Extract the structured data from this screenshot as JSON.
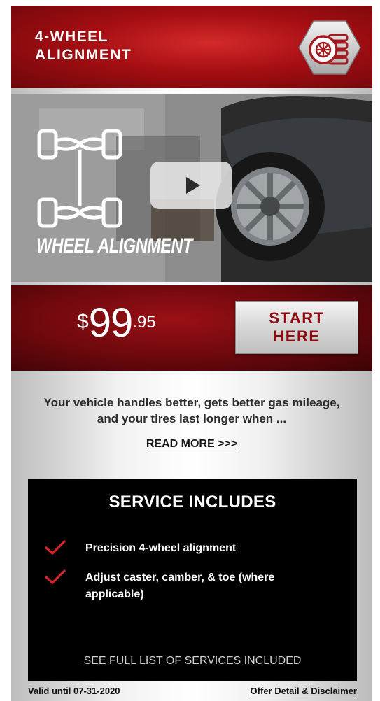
{
  "header": {
    "title": "4-WHEEL\nALIGNMENT",
    "badge_icon": "tire-stack-icon"
  },
  "hero": {
    "overlay_text": "WHEEL ALIGNMENT",
    "axle_icon": "wheel-axle-diagram-icon",
    "play_icon": "play-icon"
  },
  "offer": {
    "price_dollar": "$",
    "price_main": "99",
    "price_cents": ".95",
    "start_label": "START\nHERE"
  },
  "description": {
    "text": "Your vehicle handles better, gets better gas mileage, and your tires last longer when ...",
    "read_more": "READ MORE >>>"
  },
  "services": {
    "title": "SERVICE INCLUDES",
    "items": [
      {
        "label": "Precision 4-wheel alignment"
      },
      {
        "label": "Adjust caster, camber, & toe (where applicable)"
      }
    ],
    "see_full": "SEE FULL LIST OF SERVICES INCLUDED"
  },
  "footer": {
    "valid": "Valid until 07-31-2020",
    "disclaimer": "Offer Detail & Disclaimer"
  },
  "colors": {
    "brand_red": "#a50e12",
    "dark_red": "#6a080c",
    "check_red": "#d8232a"
  }
}
